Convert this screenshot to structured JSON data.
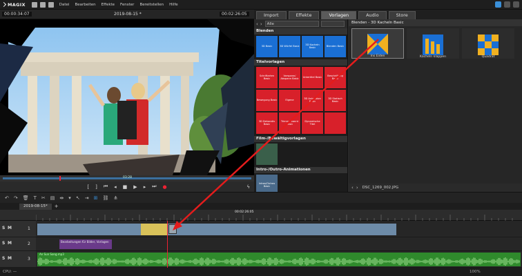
{
  "menubar": {
    "brand": "MAGIX",
    "menus": [
      "Datei",
      "Bearbeiten",
      "Effekte",
      "Fenster",
      "Bereitstellen",
      "Hilfe"
    ]
  },
  "preview": {
    "left_time": "00:00:34:07",
    "title": "2019-08-15 *",
    "right_time": "00:02:26:05",
    "scrub_label": "03:28"
  },
  "tabs": [
    {
      "label": "Import",
      "active": false
    },
    {
      "label": "Effekte",
      "active": false
    },
    {
      "label": "Vorlagen",
      "active": true
    },
    {
      "label": "Audio",
      "active": false
    },
    {
      "label": "Store",
      "active": false
    }
  ],
  "pool_nav": {
    "dropdown": "Alle"
  },
  "categories": {
    "blenden": {
      "title": "Blenden",
      "tiles": [
        "3D Basic",
        "3D Würfel Basic",
        "3D Kacheln Basic",
        "Blenden Basic"
      ]
    },
    "titel": {
      "title": "Titelvorlagen",
      "tiles": [
        "Schriftarten Basic",
        "Vorspann/ Abspann Basic",
        "Untertitel Basic",
        "Beschriftung Basic",
        "Bewegung Basic",
        "Eigene",
        "3D Animation Basic",
        "3D Statisch Basic",
        "3D Dekorativ Basic",
        "Trimmerkannt Basic",
        "Dynamische Titel",
        ""
      ]
    },
    "film": {
      "title": "Film-/Bewältigvorlagen"
    },
    "intro": {
      "title": "Intro-/Outro-Animationen",
      "tile": "Intros/Outros Basic"
    }
  },
  "detail": {
    "header": "Blenden - 3D Kacheln Basic",
    "items": [
      "Ins Eiden",
      "Kacheln klappen",
      "Quadrat"
    ],
    "footer_file": "DSC_1269_002.JPG"
  },
  "timeline": {
    "project_tab": "2019-08-15*",
    "ruler_time": "00:02:26:05",
    "track_labels": [
      "1",
      "2",
      "3"
    ],
    "clip_text_track2": "Bearbeitungen für Bilder, Vorlagen",
    "clip_text_track3": "An Sun Song.mp3",
    "zoom": "100%"
  },
  "statusbar": {
    "text": "CPU: —"
  },
  "colors": {
    "accent_blue": "#1a6fd4",
    "accent_red": "#d8202a",
    "arrow_red": "#e41c1c",
    "audio_green": "#2f8a2c",
    "clip_purple": "#6a3a8a"
  }
}
